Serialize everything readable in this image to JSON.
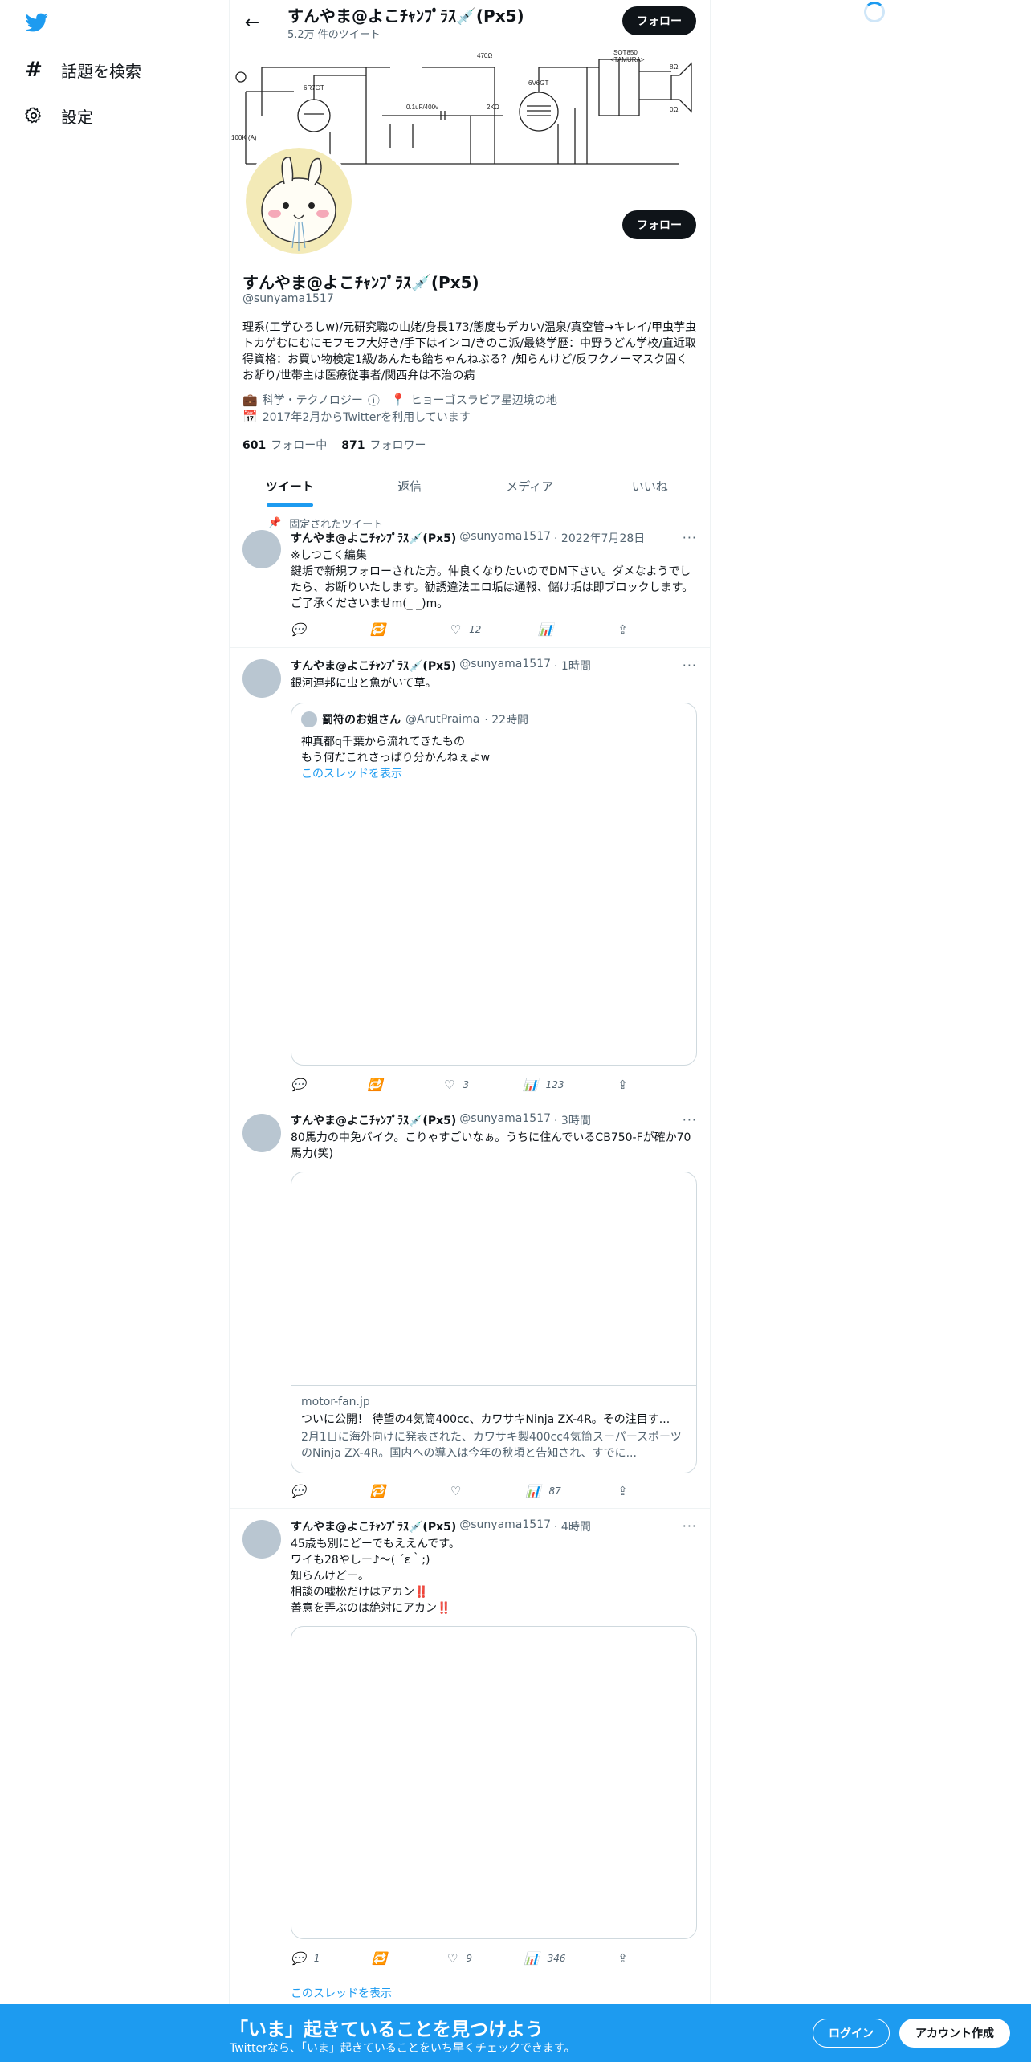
{
  "nav": {
    "explore_label": "話題を検索",
    "settings_label": "設定"
  },
  "header": {
    "name": "すんやま@よこﾁｬﾝﾌﾟﾗｽ💉(Px5)",
    "tweet_count": "5.2万 件のツイート",
    "follow_label": "フォロー"
  },
  "banner": {
    "labels": [
      "6R7GT",
      "6V6GT",
      "SOT850",
      "<TAMURA>",
      "470Ω",
      "0.1uF/400v",
      "2KΩ",
      "100K (A)",
      "8Ω",
      "0Ω"
    ]
  },
  "profile": {
    "name": "すんやま@よこﾁｬﾝﾌﾟﾗｽ💉(Px5)",
    "handle": "@sunyama1517",
    "follow_label": "フォロー",
    "bio": "理系(工学ひろしw)/元研究職の山姥/身長173/態度もデカい/温泉/真空管→キレイ/甲虫芋虫トカゲむにむにモフモフ大好き/手下はインコ/きのこ派/最終学歴：中野うどん学校/直近取得資格：お買い物検定1級/あんたも飴ちゃんねぶる？/知らんけど/反ワクノーマスク固くお断り/世帯主は医療従事者/関西弁は不治の病",
    "category": "科学・テクノロジー",
    "location": "ヒョーゴスラビア星辺境の地",
    "joined": "2017年2月からTwitterを利用しています",
    "following_count": "601",
    "following_label": "フォロー中",
    "followers_count": "871",
    "followers_label": "フォロワー"
  },
  "tabs": [
    "ツイート",
    "返信",
    "メディア",
    "いいね"
  ],
  "tweets": [
    {
      "pinned_label": "固定されたツイート",
      "name": "すんやま@よこﾁｬﾝﾌﾟﾗｽ💉(Px5)",
      "handle": "@sunyama1517",
      "time": "· 2022年7月28日",
      "text": "※しつこく編集\n鍵垢で新規フォローされた方。仲良くなりたいのでDM下さい。ダメなようでしたら、お断りいたします。勧誘違法エロ垢は通報、儲け垢は即ブロックします。ご了承くださいませm(_ _)m。",
      "reply": "",
      "retweet": "",
      "like": "12",
      "views": ""
    },
    {
      "name": "すんやま@よこﾁｬﾝﾌﾟﾗｽ💉(Px5)",
      "handle": "@sunyama1517",
      "time": "· 1時間",
      "text": "銀河連邦に虫と魚がいて草。",
      "quote": {
        "name": "罰符のお姐さん",
        "handle": "@ArutPraima",
        "time": "· 22時間",
        "text": "神真都q千葉から流れてきたもの\nもう何だこれさっぱり分かんねぇよw",
        "thread_link": "このスレッドを表示"
      },
      "reply": "",
      "retweet": "",
      "like": "3",
      "views": "123"
    },
    {
      "name": "すんやま@よこﾁｬﾝﾌﾟﾗｽ💉(Px5)",
      "handle": "@sunyama1517",
      "time": "· 3時間",
      "text": "80馬力の中免バイク。こりゃすごいなぁ。うちに住んでいるCB750-Fが確か70馬力(笑)",
      "card": {
        "domain": "motor-fan.jp",
        "title": "ついに公開！ 待望の4気筒400cc、カワサキNinja ZX-4R。その注目す...",
        "desc": "2月1日に海外向けに発表された、カワサキ製400cc4気筒スーパースポーツのNinja ZX-4R。国内への導入は今年の秋頃と告知され、すでに..."
      },
      "reply": "",
      "retweet": "",
      "like": "",
      "views": "87"
    },
    {
      "name": "すんやま@よこﾁｬﾝﾌﾟﾗｽ💉(Px5)",
      "handle": "@sunyama1517",
      "time": "· 4時間",
      "text": "45歳も別にどーでもええんです。\nワイも28やしー♪～( ´ε｀;)\n知らんけどー。\n相談の嘘松だけはアカン‼️\n善意を弄ぶのは絶対にアカン‼️",
      "reply": "1",
      "retweet": "",
      "like": "9",
      "views": "346",
      "thread_link": "このスレッドを表示"
    }
  ],
  "bottom_bar": {
    "title": "「いま」起きていることを見つけよう",
    "subtitle": "Twitterなら、「いま」起きていることをいち早くチェックできます。",
    "login_label": "ログイン",
    "signup_label": "アカウント作成"
  },
  "colors": {
    "accent": "#1d9bf0",
    "text": "#0f1419",
    "muted": "#536471"
  }
}
